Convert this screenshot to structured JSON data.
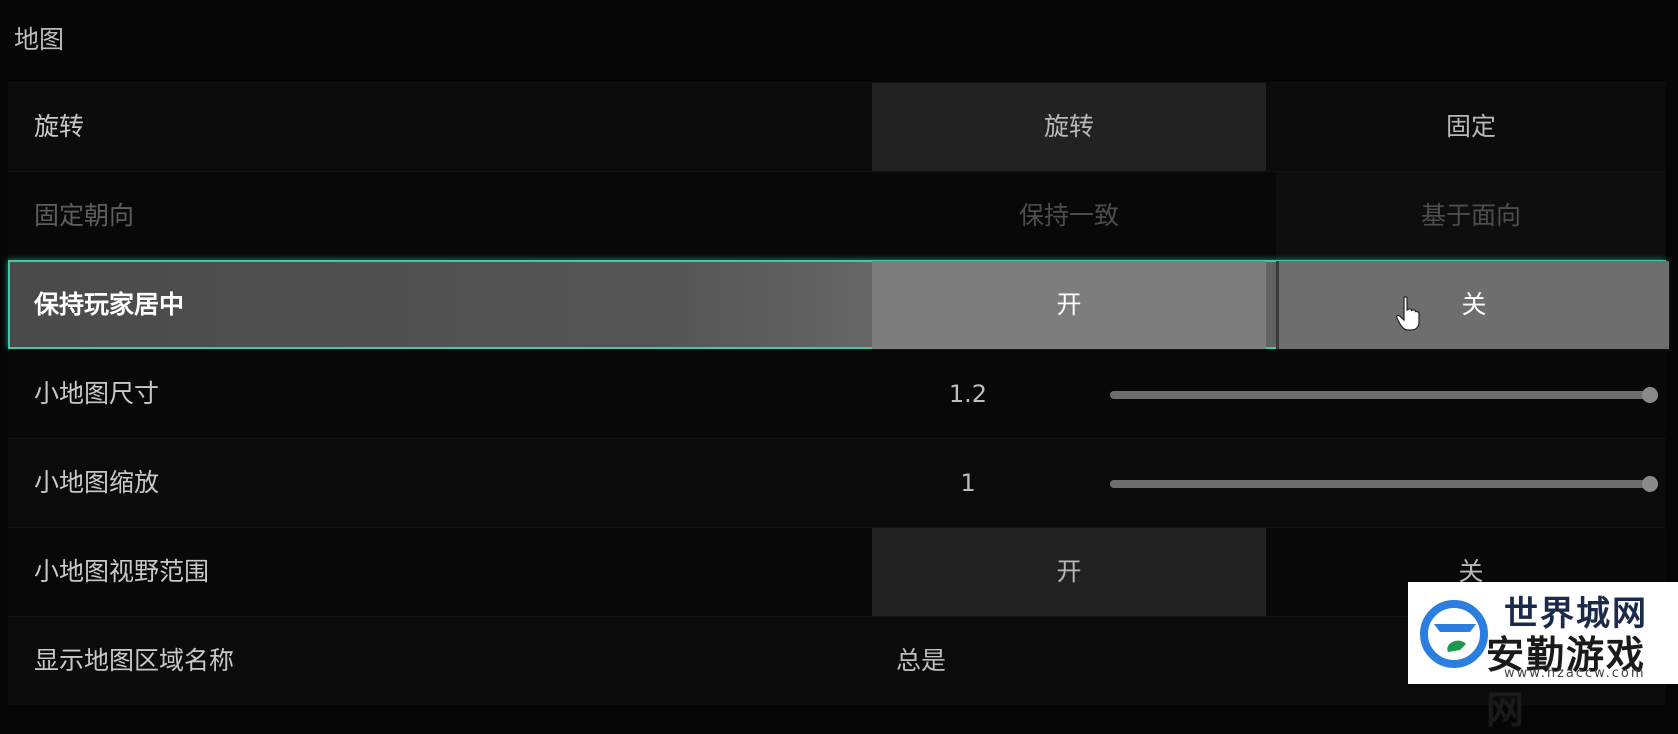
{
  "section": {
    "title": "地图"
  },
  "rows": {
    "rotation": {
      "label": "旋转",
      "option_a": "旋转",
      "option_b": "固定"
    },
    "fixed_orientation": {
      "label": "固定朝向",
      "option_a": "保持一致",
      "option_b": "基于面向"
    },
    "keep_player_centered": {
      "label": "保持玩家居中",
      "option_a": "开",
      "option_b": "关"
    },
    "minimap_size": {
      "label": "小地图尺寸",
      "value": "1.2",
      "fraction": 1.0
    },
    "minimap_zoom": {
      "label": "小地图缩放",
      "value": "1",
      "fraction": 1.0
    },
    "minimap_view_range": {
      "label": "小地图视野范围",
      "option_a": "开",
      "option_b": "关"
    },
    "show_region_names": {
      "label": "显示地图区域名称",
      "value": "总是"
    }
  },
  "watermark": {
    "line1": "世界城网",
    "line2": "安勤游戏网",
    "url": "www.hzaccw.com"
  },
  "colors": {
    "focus_border": "#43c7a7",
    "selected_bg": "#222222",
    "focused_bg": "#555555"
  }
}
